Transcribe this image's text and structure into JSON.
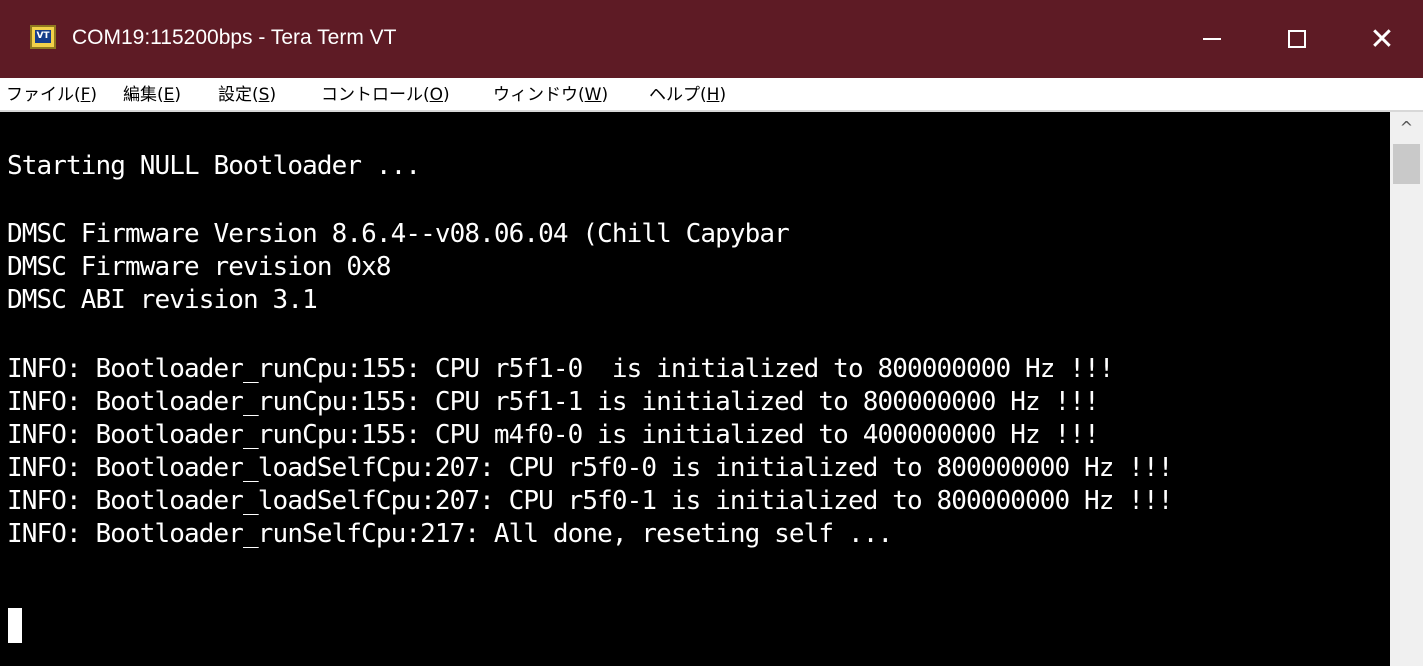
{
  "window": {
    "title": "COM19:115200bps - Tera Term VT",
    "icon_label": "VT",
    "icon_name": "tera-term-vt-icon",
    "controls": {
      "minimize": "minimize-icon",
      "maximize": "maximize-icon",
      "close_glyph": "✕"
    }
  },
  "menu": {
    "items": [
      {
        "label": "ファイル(",
        "accel": "F",
        "suffix": ")"
      },
      {
        "label": "編集(",
        "accel": "E",
        "suffix": ")"
      },
      {
        "label": "設定(",
        "accel": "S",
        "suffix": ")"
      },
      {
        "label": "コントロール(",
        "accel": "O",
        "suffix": ")"
      },
      {
        "label": "ウィンドウ(",
        "accel": "W",
        "suffix": ")"
      },
      {
        "label": "ヘルプ(",
        "accel": "H",
        "suffix": ")"
      }
    ]
  },
  "terminal": {
    "lines": [
      "Starting NULL Bootloader ...",
      "",
      "DMSC Firmware Version 8.6.4--v08.06.04 (Chill Capybar",
      "DMSC Firmware revision 0x8",
      "DMSC ABI revision 3.1",
      "",
      "INFO: Bootloader_runCpu:155: CPU r5f1-0  is initialized to 800000000 Hz !!!",
      "INFO: Bootloader_runCpu:155: CPU r5f1-1 is initialized to 800000000 Hz !!!",
      "INFO: Bootloader_runCpu:155: CPU m4f0-0 is initialized to 400000000 Hz !!!",
      "INFO: Bootloader_loadSelfCpu:207: CPU r5f0-0 is initialized to 800000000 Hz !!!",
      "INFO: Bootloader_loadSelfCpu:207: CPU r5f0-1 is initialized to 800000000 Hz !!!",
      "INFO: Bootloader_runSelfCpu:217: All done, reseting self ..."
    ],
    "foreground": "#ffffff",
    "background": "#000000"
  },
  "scrollbar": {
    "up_glyph": "^"
  },
  "colors": {
    "titlebar": "#5e1b25",
    "menubar": "#ffffff"
  }
}
